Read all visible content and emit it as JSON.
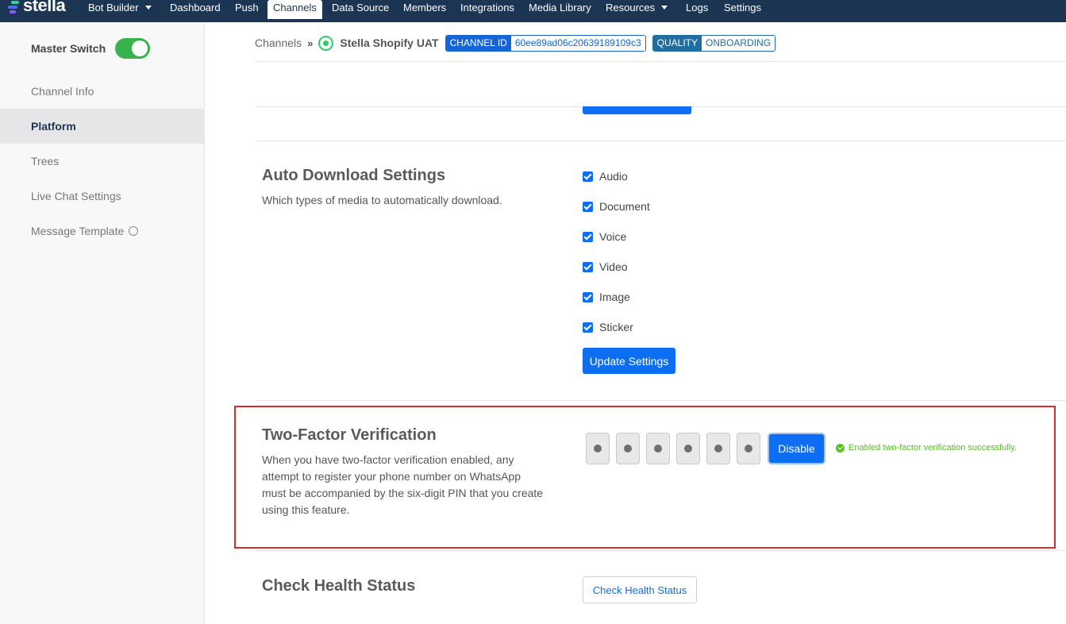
{
  "app": {
    "logo_text": "stella",
    "brand_colors": [
      "#2bd4a4",
      "#4a6cf7",
      "#8a5cf6"
    ]
  },
  "nav": {
    "items": [
      {
        "label": "Bot Builder",
        "dropdown": true
      },
      {
        "label": "Dashboard"
      },
      {
        "label": "Push"
      },
      {
        "label": "Channels",
        "active": true
      },
      {
        "label": "Data Source"
      },
      {
        "label": "Members"
      },
      {
        "label": "Integrations"
      },
      {
        "label": "Media Library"
      },
      {
        "label": "Resources",
        "dropdown": true
      },
      {
        "label": "Logs"
      },
      {
        "label": "Settings"
      }
    ]
  },
  "sidebar": {
    "master_switch_label": "Master Switch",
    "master_switch_on": true,
    "items": [
      {
        "label": "Channel Info"
      },
      {
        "label": "Platform",
        "active": true
      },
      {
        "label": "Trees"
      },
      {
        "label": "Live Chat Settings"
      },
      {
        "label": "Message Template",
        "icon": "whatsapp-icon"
      }
    ]
  },
  "breadcrumb": {
    "root": "Channels",
    "channel_name": "Stella Shopify UAT",
    "channel_id_label": "CHANNEL ID",
    "channel_id_value": "60ee89ad06c20639189109c3",
    "quality_label": "QUALITY",
    "quality_value": "ONBOARDING"
  },
  "auto_download": {
    "title": "Auto Download Settings",
    "description": "Which types of media to automatically download.",
    "options": [
      {
        "label": "Audio",
        "checked": true
      },
      {
        "label": "Document",
        "checked": true
      },
      {
        "label": "Voice",
        "checked": true
      },
      {
        "label": "Video",
        "checked": true
      },
      {
        "label": "Image",
        "checked": true
      },
      {
        "label": "Sticker",
        "checked": true
      }
    ],
    "update_button": "Update Settings"
  },
  "two_factor": {
    "title": "Two-Factor Verification",
    "description": "When you have two-factor verification enabled, any attempt to register your phone number on WhatsApp must be accompanied by the six-digit PIN that you create using this feature.",
    "pin_digits": 6,
    "disable_button": "Disable",
    "status_message": "Enabled two-factor verification successfully.",
    "status_color": "#52c41a"
  },
  "health": {
    "title": "Check Health Status",
    "button": "Check Health Status"
  }
}
